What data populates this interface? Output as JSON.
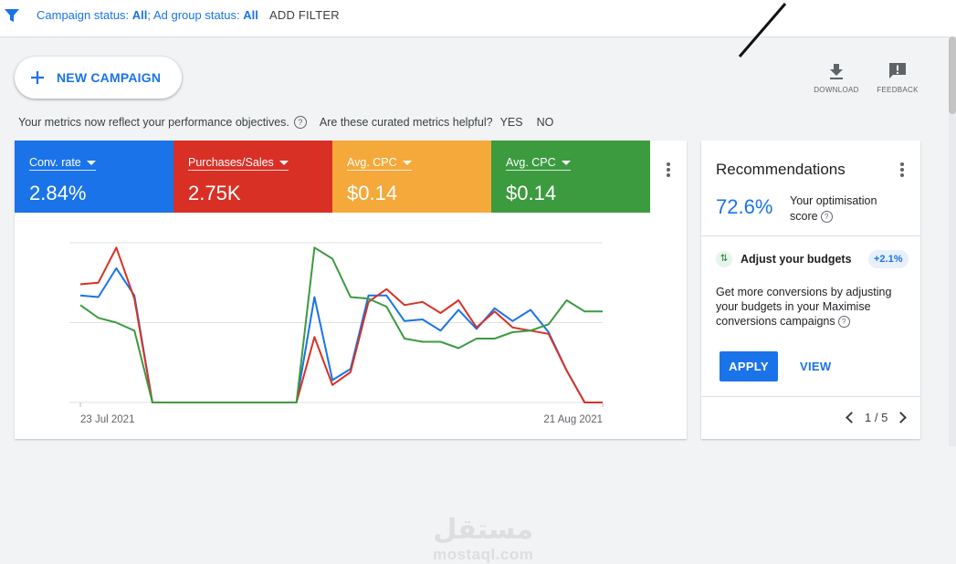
{
  "filter_bar": {
    "campaign_status_label": "Campaign status:",
    "campaign_status_value": "All",
    "separator": ";",
    "ad_group_status_label": "Ad group status:",
    "ad_group_status_value": "All",
    "add_filter": "ADD FILTER"
  },
  "new_campaign": {
    "label": "NEW CAMPAIGN"
  },
  "tools": {
    "download": "DOWNLOAD",
    "feedback": "FEEDBACK"
  },
  "notice": {
    "text": "Your metrics now reflect your performance objectives.",
    "question": "Are these curated metrics helpful?",
    "yes": "YES",
    "no": "NO"
  },
  "metrics": [
    {
      "name": "Conv. rate",
      "value": "2.84%",
      "color": "#1a73e8"
    },
    {
      "name": "Purchases/Sales",
      "value": "2.75K",
      "color": "#d93025"
    },
    {
      "name": "Avg. CPC",
      "value": "$0.14",
      "color": "#f4a93a"
    },
    {
      "name": "Avg. CPC",
      "value": "$0.14",
      "color": "#3c9a3f"
    }
  ],
  "chart_data": {
    "type": "line",
    "x_start_label": "23 Jul 2021",
    "x_end_label": "21 Aug 2021",
    "x": [
      0,
      1,
      2,
      3,
      4,
      5,
      6,
      7,
      8,
      9,
      10,
      11,
      12,
      13,
      14,
      15,
      16,
      17,
      18,
      19,
      20,
      21,
      22,
      23,
      24,
      25,
      26,
      27,
      28,
      29
    ],
    "grid": true,
    "series": [
      {
        "color": "#1a73e8",
        "values": [
          67,
          66,
          84,
          67,
          0,
          0,
          0,
          0,
          0,
          0,
          0,
          0,
          0,
          66,
          14,
          21,
          67,
          67,
          51,
          52,
          45,
          58,
          46,
          59,
          51,
          58,
          44,
          20,
          0,
          0
        ]
      },
      {
        "color": "#d93025",
        "values": [
          74,
          75,
          97,
          65,
          0,
          0,
          0,
          0,
          0,
          0,
          0,
          0,
          0,
          41,
          11,
          19,
          63,
          71,
          61,
          63,
          56,
          64,
          47,
          57,
          47,
          45,
          43,
          20,
          0,
          0
        ]
      },
      {
        "color": "#3c9a3f",
        "values": [
          61,
          53,
          50,
          45,
          0,
          0,
          0,
          0,
          0,
          0,
          0,
          0,
          0,
          97,
          90,
          66,
          65,
          60,
          40,
          38,
          38,
          34,
          40,
          40,
          44,
          45,
          49,
          64,
          57,
          57
        ]
      }
    ]
  },
  "recommendations": {
    "title": "Recommendations",
    "score": "72.6%",
    "score_label_1": "Your optimisation",
    "score_label_2": "score",
    "item_title": "Adjust your budgets",
    "item_badge": "+2.1%",
    "item_desc": "Get more conversions by adjusting your budgets in your Maximise conversions campaigns",
    "apply": "APPLY",
    "view": "VIEW",
    "pager": "1 / 5"
  },
  "watermark": {
    "arabic": "مستقل",
    "latin": "mostaql.com"
  }
}
